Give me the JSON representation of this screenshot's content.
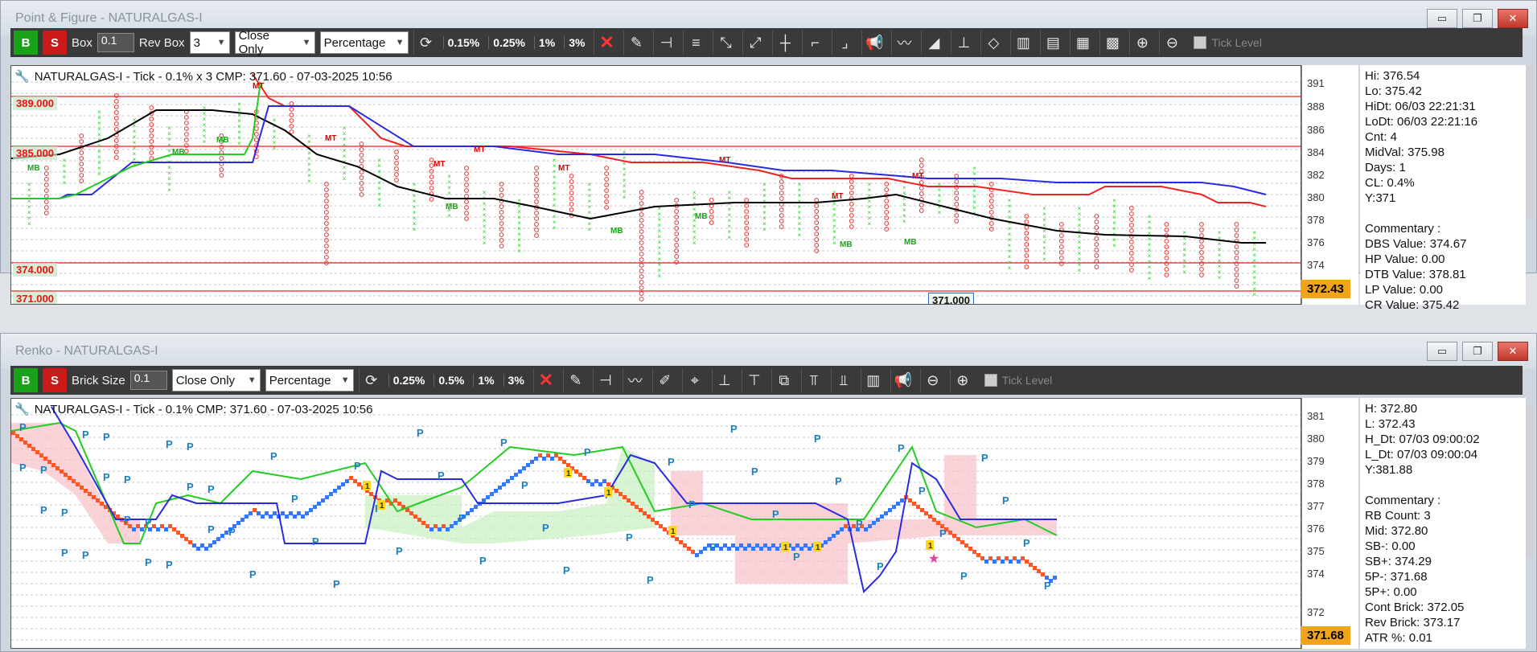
{
  "pf": {
    "window_title": "Point & Figure - NATURALGAS-I",
    "toolbar": {
      "buy": "B",
      "sell": "S",
      "box_label": "Box",
      "box_value": "0.1",
      "rev_label": "Rev Box",
      "rev_value": "3",
      "price_mode": "Close Only",
      "calc_mode": "Percentage",
      "pcts": [
        "0.15%",
        "0.25%",
        "1%",
        "3%"
      ],
      "tick_level": "Tick Level"
    },
    "header": "NATURALGAS-I - Tick - 0.1% x 3 CMP: 371.60 - 07-03-2025 10:56",
    "levels": [
      "389.000",
      "385.000",
      "374.000",
      "371.000"
    ],
    "bottom_level": "371.000",
    "yticks": [
      "391",
      "388",
      "386",
      "384",
      "382",
      "380",
      "378",
      "376",
      "374"
    ],
    "cmp_badge": "372.43",
    "marks": {
      "mt": "MT",
      "mb": "MB"
    },
    "info": [
      "Hi: 376.54",
      "Lo: 375.42",
      "HiDt: 06/03 22:21:31",
      "LoDt: 06/03 22:21:16",
      "Cnt: 4",
      "MidVal: 375.98",
      "Days: 1",
      "CL: 0.4%",
      "Y:371",
      "",
      "Commentary :",
      "DBS Value:  374.67",
      "HP Value: 0.00",
      "DTB Value: 378.81",
      "LP Value: 0.00",
      "CR Value: 375.42"
    ]
  },
  "renko": {
    "window_title": "Renko - NATURALGAS-I",
    "toolbar": {
      "buy": "B",
      "sell": "S",
      "brick_label": "Brick Size",
      "brick_value": "0.1",
      "price_mode": "Close Only",
      "calc_mode": "Percentage",
      "pcts": [
        "0.25%",
        "0.5%",
        "1%",
        "3%"
      ],
      "tick_level": "Tick Level"
    },
    "header": "NATURALGAS-I - Tick - 0.1% CMP: 371.60 - 07-03-2025 10:56",
    "yticks": [
      "381",
      "380",
      "379",
      "378",
      "377",
      "376",
      "375",
      "374",
      "372"
    ],
    "cmp_badge": "371.68",
    "marks": {
      "p": "P",
      "one": "1"
    },
    "info": [
      "H: 372.80",
      "L: 372.43",
      "H_Dt: 07/03 09:00:02",
      "L_Dt: 07/03 09:00:04",
      "Y:381.88",
      "",
      "Commentary :",
      "RB Count: 3",
      "Mid: 372.80",
      "SB-: 0.00",
      "SB+: 374.29",
      "5P-: 371.68",
      "5P+: 0.00",
      "Cont Brick: 372.05",
      "Rev Brick: 373.17",
      "ATR %: 0.01"
    ]
  },
  "window_buttons": {
    "minimize": "▭",
    "maximize": "❐",
    "close": "✕"
  },
  "colors": {
    "up": "#22cc22",
    "down": "#e53030",
    "blue": "#2a2ae0",
    "cmp": "#f0a417"
  }
}
